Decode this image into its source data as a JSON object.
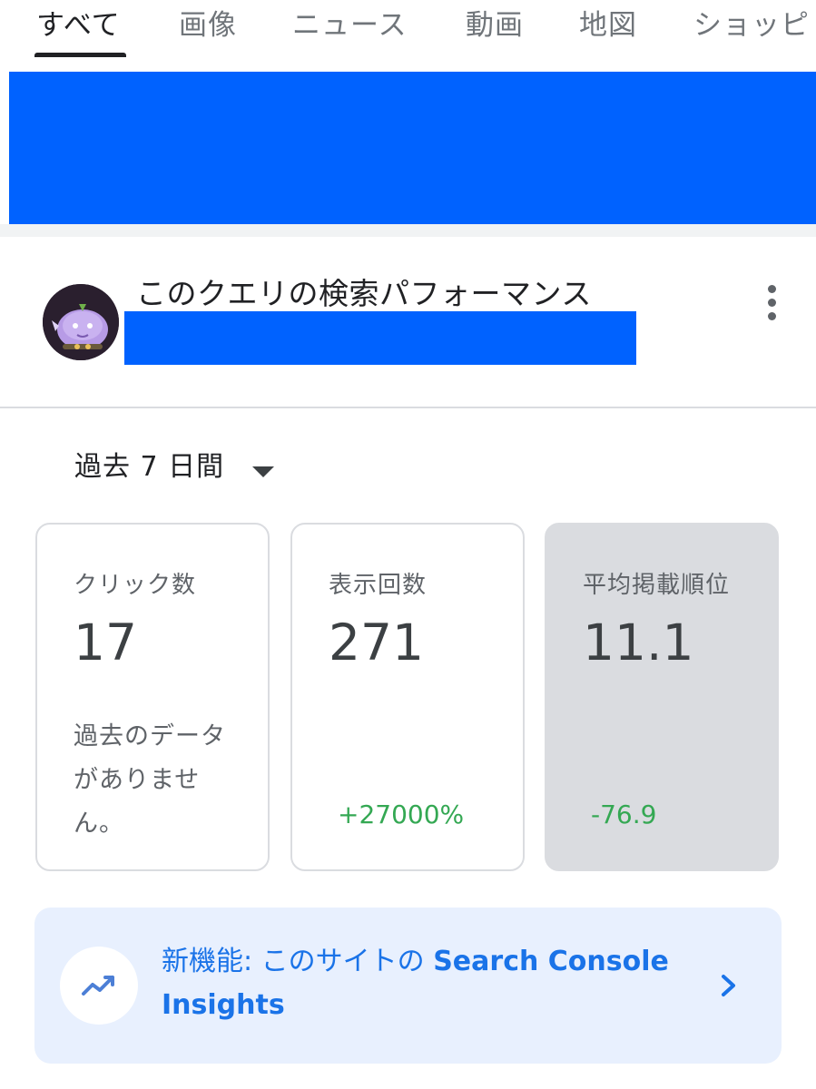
{
  "tabs": [
    {
      "label": "すべて",
      "active": true
    },
    {
      "label": "画像"
    },
    {
      "label": "ニュース"
    },
    {
      "label": "動画"
    },
    {
      "label": "地図"
    },
    {
      "label": "ショッピ"
    }
  ],
  "card": {
    "title": "このクエリの検索パフォーマンス"
  },
  "date_range": {
    "label": "過去 7 日間"
  },
  "metrics": [
    {
      "label": "クリック数",
      "value": "17",
      "note": "過去のデータがありません。",
      "change": ""
    },
    {
      "label": "表示回数",
      "value": "271",
      "note": "",
      "change": "+27000%"
    },
    {
      "label": "平均掲載順位",
      "value": "11.1",
      "note": "",
      "change": "-76.9",
      "selected": true
    }
  ],
  "insights": {
    "lead": "新機能: このサイトの",
    "product": "Search Console Insights"
  },
  "colors": {
    "accent_blue": "#1a73e8",
    "positive_green": "#34a853",
    "redaction": "#0062ff",
    "insights_bg": "#e8f0fe"
  },
  "icons": [
    "more-vert-icon",
    "dropdown-caret-icon",
    "trending-up-icon",
    "chevron-right-icon"
  ]
}
